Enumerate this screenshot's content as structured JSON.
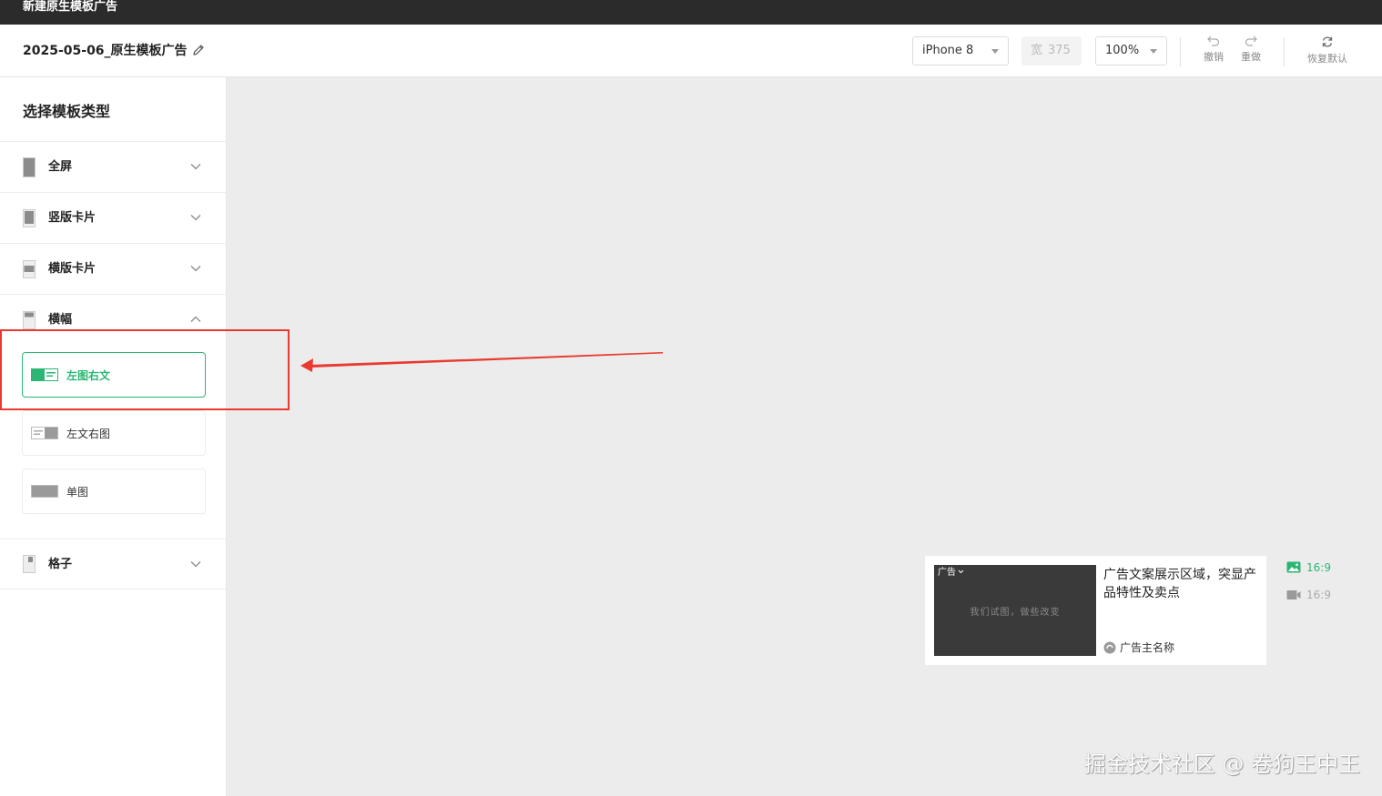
{
  "window": {
    "title": "新建原生模板广告"
  },
  "toolbar": {
    "doc_name": "2025-05-06_原生模板广告",
    "device": "iPhone 8",
    "width_label": "宽",
    "width_value": "375",
    "zoom": "100%",
    "undo": "撤销",
    "redo": "重做",
    "reset": "恢复默认"
  },
  "sidebar": {
    "title": "选择模板类型",
    "categories": [
      {
        "label": "全屏",
        "expanded": false
      },
      {
        "label": "竖版卡片",
        "expanded": false
      },
      {
        "label": "横版卡片",
        "expanded": false
      },
      {
        "label": "横幅",
        "expanded": true
      },
      {
        "label": "格子",
        "expanded": false
      }
    ],
    "banner_options": [
      {
        "label": "左图右文",
        "selected": true
      },
      {
        "label": "左文右图",
        "selected": false
      },
      {
        "label": "单图",
        "selected": false
      }
    ]
  },
  "preview": {
    "ad_tag": "广告",
    "thumb_slogan": "我们试图，做些改变",
    "copy": "广告文案展示区域，突显产品特性及卖点",
    "advertiser": "广告主名称"
  },
  "ratios": {
    "image": "16:9",
    "video": "16:9"
  },
  "colors": {
    "accent": "#2bb673",
    "annotation": "#e83a2f"
  },
  "watermark": "掘金技术社区 @ 卷狗王中王"
}
